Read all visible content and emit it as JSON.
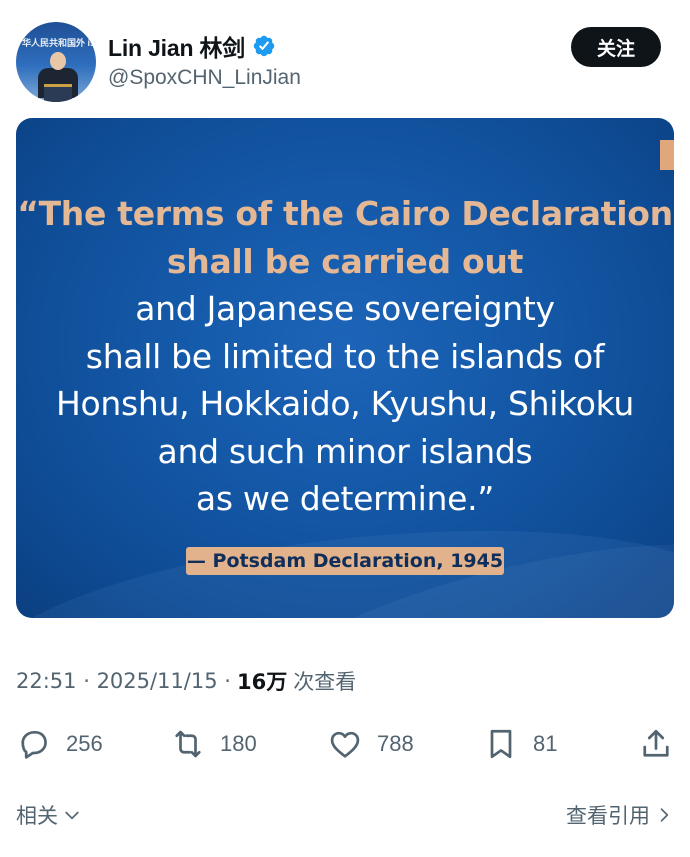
{
  "author": {
    "display_name": "Lin Jian 林剑",
    "handle": "@SpoxCHN_LinJian",
    "avatar_banner_text": "华人民共和国外 istry of Foreign A"
  },
  "follow_label": "关注",
  "media": {
    "quote_highlight": [
      "“The terms of the Cairo Declaration",
      "shall be carried out"
    ],
    "quote_body": [
      "and Japanese sovereignty",
      "shall be limited to the islands of",
      "Honshu, Hokkaido, Kyushu, Shikoku",
      "and such minor islands",
      "as we determine.”"
    ],
    "source": "— Potsdam Declaration, 1945"
  },
  "meta": {
    "time": "22:51",
    "date": "2025/11/15",
    "views": "16万",
    "views_label": "次查看"
  },
  "actions": {
    "replies": "256",
    "reposts": "180",
    "likes": "788",
    "bookmarks": "81"
  },
  "footer": {
    "related": "相关",
    "view_quotes": "查看引用"
  },
  "colors": {
    "verified": "#1d9bf0",
    "card_blue": "#155aaa",
    "highlight_tan": "#e4b894",
    "muted_text": "#536471"
  }
}
